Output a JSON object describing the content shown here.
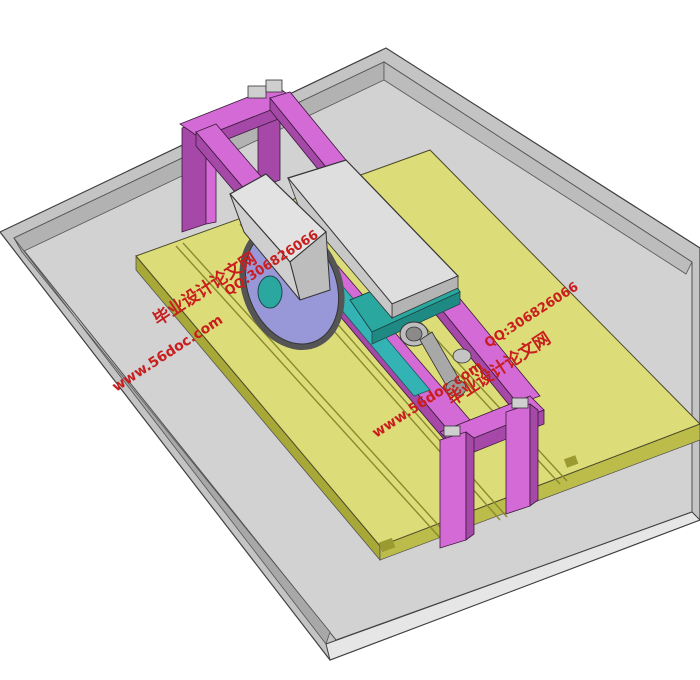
{
  "watermarks": [
    {
      "id": "wm1",
      "title": "毕业设计论文网",
      "qq": "QQ:306826066",
      "site": "www.56doc.com"
    },
    {
      "id": "wm2",
      "title": "毕业设计论文网",
      "qq": "QQ:306826066",
      "site": "www.56doc.com"
    }
  ],
  "colors": {
    "background": "#ffffff",
    "tray_top": "#c8c8c8",
    "tray_floor": "#d4d4d4",
    "tray_wall_dark": "#a8a8a8",
    "base_plate": "#dcdc78",
    "base_plate_side": "#b9b94a",
    "frame_magenta": "#d46ad6",
    "frame_magenta_dark": "#a548a8",
    "housing_gray": "#d9d9d9",
    "blade_blue": "#9898d8",
    "hub_teal": "#2aa8a0",
    "slide_teal": "#33b3b3",
    "watermark_red": "#c81e1e"
  },
  "icons": [
    "cutting-machine-assembly"
  ]
}
